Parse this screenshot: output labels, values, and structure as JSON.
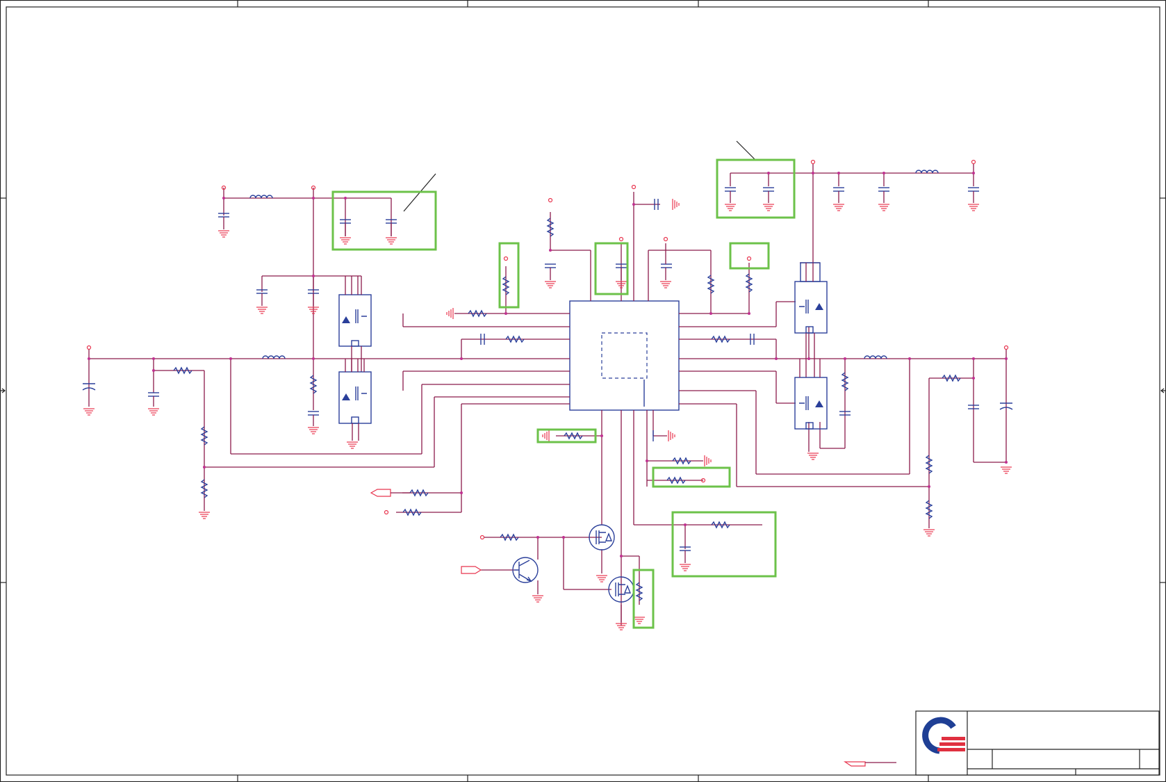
{
  "colors": {
    "wire": "#8b1a4a",
    "component": "#2a3f9a",
    "pin": "#e8344e",
    "highlight": "#6cc24a",
    "border": "#222222",
    "logo_blue": "#1f3f95",
    "logo_red": "#e03040"
  },
  "icons": {
    "logo": "company-logo-icon",
    "ground": "ground-icon",
    "port": "offpage-connector-icon"
  },
  "texts": {}
}
